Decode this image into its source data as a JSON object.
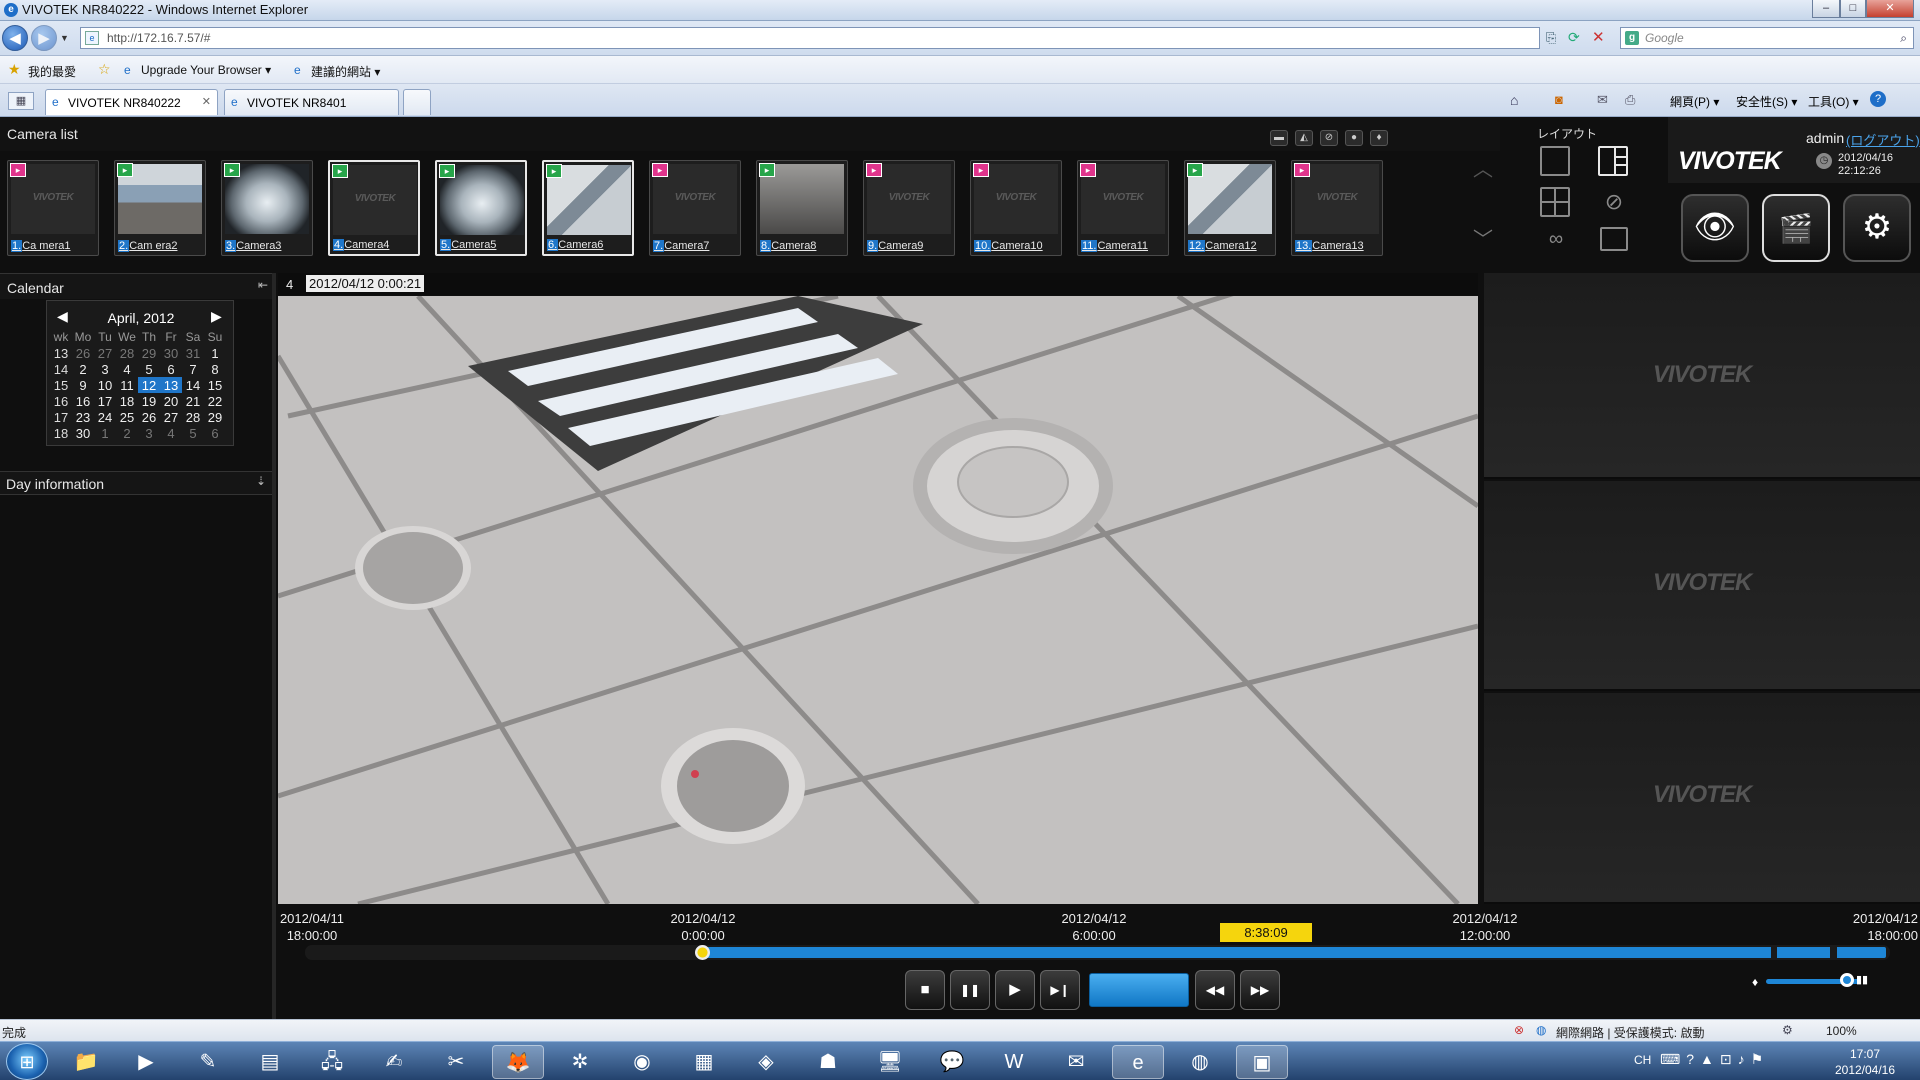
{
  "window": {
    "title": "VIVOTEK NR840222 - Windows Internet Explorer",
    "controls": [
      "–",
      "□",
      "✕"
    ]
  },
  "browser": {
    "url": "http://172.16.7.57/#",
    "search_placeholder": "Google",
    "favorites": {
      "label": "我的最愛",
      "items": [
        "Upgrade Your Browser ▾",
        "建議的網站 ▾"
      ]
    },
    "tabs": [
      {
        "label": "VIVOTEK NR840222",
        "active": true,
        "close": "✕"
      },
      {
        "label": "VIVOTEK NR8401",
        "active": false
      }
    ],
    "command_bar": [
      "網頁(P) ▾",
      "安全性(S) ▾",
      "工具(O) ▾"
    ],
    "status_text": "完成",
    "zone_text": "網際網路 | 受保護模式: 啟動",
    "zoom": "100%"
  },
  "app": {
    "camera_list_label": "Camera list",
    "cameras": [
      {
        "num": "1.",
        "name": "Ca mera1",
        "badge": "pink",
        "thumb": "logo",
        "selected": false
      },
      {
        "num": "2.",
        "name": "Cam era2",
        "badge": "green",
        "thumb": "office",
        "selected": false
      },
      {
        "num": "3.",
        "name": "Camera3",
        "badge": "green",
        "thumb": "fisheye",
        "selected": false
      },
      {
        "num": "4.",
        "name": "Camera4",
        "badge": "green",
        "thumb": "logo",
        "selected": true
      },
      {
        "num": "5.",
        "name": "Camera5",
        "badge": "green",
        "thumb": "fisheye",
        "selected": true
      },
      {
        "num": "6.",
        "name": "Camera6",
        "badge": "green",
        "thumb": "ceiling",
        "selected": true
      },
      {
        "num": "7.",
        "name": "Camera7",
        "badge": "pink",
        "thumb": "logo",
        "selected": false
      },
      {
        "num": "8.",
        "name": "Camera8",
        "badge": "green",
        "thumb": "room",
        "selected": false
      },
      {
        "num": "9.",
        "name": "Camera9",
        "badge": "pink",
        "thumb": "logo",
        "selected": false
      },
      {
        "num": "10.",
        "name": "Camera10",
        "badge": "pink",
        "thumb": "logo",
        "selected": false
      },
      {
        "num": "11.",
        "name": "Camera11",
        "badge": "pink",
        "thumb": "logo",
        "selected": false
      },
      {
        "num": "12.",
        "name": "Camera12",
        "badge": "green",
        "thumb": "ceiling",
        "selected": false
      },
      {
        "num": "13.",
        "name": "Camera13",
        "badge": "pink",
        "thumb": "logo",
        "selected": false
      }
    ],
    "layout_label": "レイアウト",
    "user": "admin",
    "logout": "(ログアウト)",
    "brand": "VIVOTEK",
    "clock_date": "2012/04/16",
    "clock_time": "22:12:26",
    "thumb_logo": "VIVOTEK",
    "calendar": {
      "label": "Calendar",
      "month": "April, 2012",
      "prev": "◀",
      "next": "▶",
      "headers": [
        "wk",
        "Mo",
        "Tu",
        "We",
        "Th",
        "Fr",
        "Sa",
        "Su"
      ],
      "rows": [
        [
          "13",
          "26",
          "27",
          "28",
          "29",
          "30",
          "31",
          "1"
        ],
        [
          "14",
          "2",
          "3",
          "4",
          "5",
          "6",
          "7",
          "8"
        ],
        [
          "15",
          "9",
          "10",
          "11",
          "12",
          "13",
          "14",
          "15"
        ],
        [
          "16",
          "16",
          "17",
          "18",
          "19",
          "20",
          "21",
          "22"
        ],
        [
          "17",
          "23",
          "24",
          "25",
          "26",
          "27",
          "28",
          "29"
        ],
        [
          "18",
          "30",
          "1",
          "2",
          "3",
          "4",
          "5",
          "6"
        ]
      ],
      "highlighted": [
        "12",
        "13"
      ]
    },
    "day_info_label": "Day information",
    "view": {
      "channel": "4",
      "timestamp": "2012/04/12 0:00:21"
    },
    "timeline": {
      "labels": [
        {
          "date": "2012/04/11",
          "time": "18:00:00"
        },
        {
          "date": "2012/04/12",
          "time": "0:00:00"
        },
        {
          "date": "2012/04/12",
          "time": "6:00:00"
        },
        {
          "date": "2012/04/12",
          "time": "12:00:00"
        },
        {
          "date": "2012/04/12",
          "time": "18:00:00"
        }
      ],
      "cursor_time": "8:38:09"
    },
    "controls": {
      "stop": "■",
      "pause": "❚❚",
      "play": "▶",
      "step": "▶❙",
      "rewind": "◀◀",
      "forward": "▶▶"
    }
  },
  "taskbar": {
    "clock_time": "17:07",
    "clock_date": "2012/04/16",
    "lang": "CH"
  }
}
